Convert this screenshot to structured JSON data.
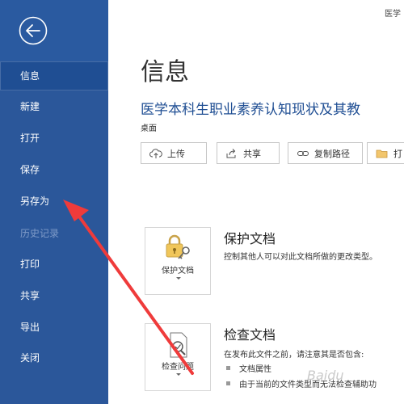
{
  "window": {
    "top_right_text": "医学"
  },
  "sidebar": {
    "items": [
      {
        "label": "信息",
        "state": "active"
      },
      {
        "label": "新建",
        "state": "normal"
      },
      {
        "label": "打开",
        "state": "normal"
      },
      {
        "label": "保存",
        "state": "normal"
      },
      {
        "label": "另存为",
        "state": "normal"
      },
      {
        "label": "历史记录",
        "state": "disabled"
      },
      {
        "label": "打印",
        "state": "normal"
      },
      {
        "label": "共享",
        "state": "normal"
      },
      {
        "label": "导出",
        "state": "normal"
      },
      {
        "label": "关闭",
        "state": "normal"
      }
    ]
  },
  "main": {
    "page_title": "信息",
    "document_title": "医学本科生职业素养认知现状及其教",
    "document_location": "桌面",
    "actions": [
      {
        "label": "上传",
        "icon": "upload-icon"
      },
      {
        "label": "共享",
        "icon": "share-icon"
      },
      {
        "label": "复制路径",
        "icon": "link-icon"
      },
      {
        "label": "打",
        "icon": "folder-icon"
      }
    ],
    "protect": {
      "card_label": "保护文档",
      "title": "保护文档",
      "description": "控制其他人可以对此文档所做的更改类型。"
    },
    "inspect": {
      "card_label": "检查问题",
      "title": "检查文档",
      "description": "在发布此文件之前，请注意其是否包含:",
      "bullets": [
        "文档属性",
        "由于当前的文件类型而无法检查辅助功"
      ]
    }
  },
  "watermark": "Baidu"
}
